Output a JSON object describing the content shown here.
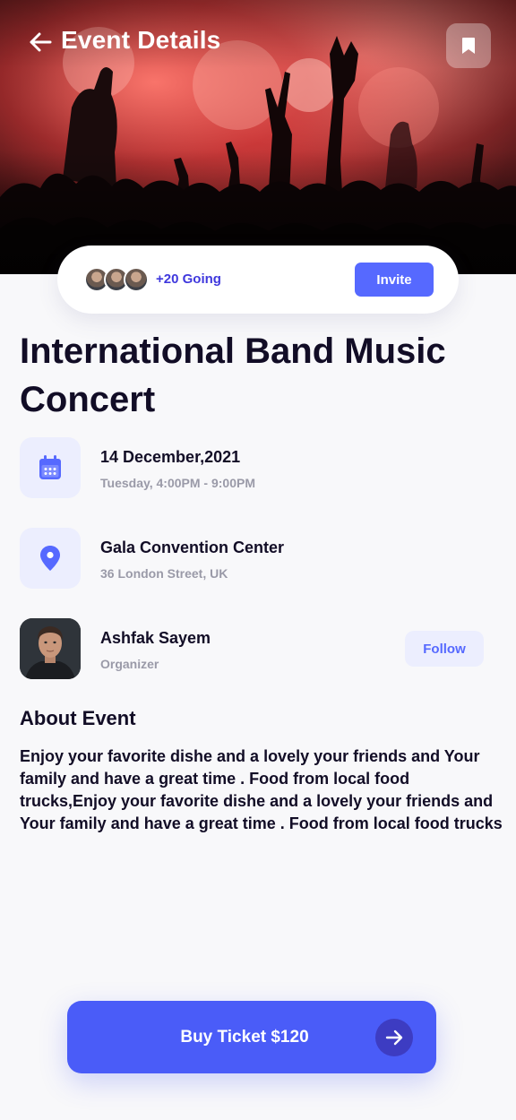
{
  "header": {
    "title": "Event Details",
    "back_icon": "arrow-left-icon",
    "bookmark_icon": "bookmark-icon"
  },
  "attendees": {
    "going_text": "+20 Going",
    "invite_label": "Invite"
  },
  "event": {
    "title": "International Band Music Concert",
    "date": "14 December,2021",
    "time": "Tuesday, 4:00PM - 9:00PM",
    "venue": "Gala Convention Center",
    "address": "36 London Street, UK"
  },
  "organizer": {
    "name": "Ashfak Sayem",
    "role": "Organizer",
    "follow_label": "Follow"
  },
  "about": {
    "heading": "About Event",
    "text": "Enjoy your favorite dishe and a lovely your friends and Your family and have a great time . Food from local food trucks,Enjoy your favorite dishe and a lovely your friends and Your family and have a great time . Food from local food trucks"
  },
  "cta": {
    "label": "Buy Ticket $120",
    "icon": "arrow-right-icon"
  },
  "colors": {
    "accent": "#5669ff",
    "cta": "#4a5cf8",
    "going_text": "#3f38dd",
    "icon_bg": "#eceefe",
    "text_primary": "#120d26",
    "text_secondary": "#9a9aa8"
  }
}
